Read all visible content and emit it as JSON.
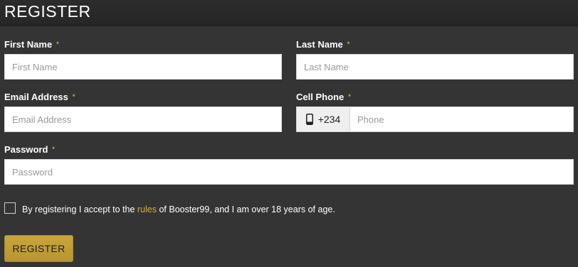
{
  "header": {
    "title": "REGISTER"
  },
  "form": {
    "required_marker": "*",
    "first_name": {
      "label": "First Name",
      "placeholder": "First Name",
      "value": ""
    },
    "last_name": {
      "label": "Last Name",
      "placeholder": "Last Name",
      "value": ""
    },
    "email": {
      "label": "Email Address",
      "placeholder": "Email Address",
      "value": ""
    },
    "cell_phone": {
      "label": "Cell Phone",
      "country_code": "+234",
      "placeholder": "Phone",
      "value": "",
      "icon": "mobile-phone-icon"
    },
    "password": {
      "label": "Password",
      "placeholder": "Password",
      "value": ""
    },
    "terms": {
      "checked": false,
      "text_before": "By registering I accept to the ",
      "link_text": "rules",
      "text_after": " of Booster99, and I am over 18 years of age."
    },
    "submit_label": "REGISTER"
  },
  "colors": {
    "background": "#343434",
    "accent": "#c9a63a",
    "link": "#d4b03a"
  }
}
